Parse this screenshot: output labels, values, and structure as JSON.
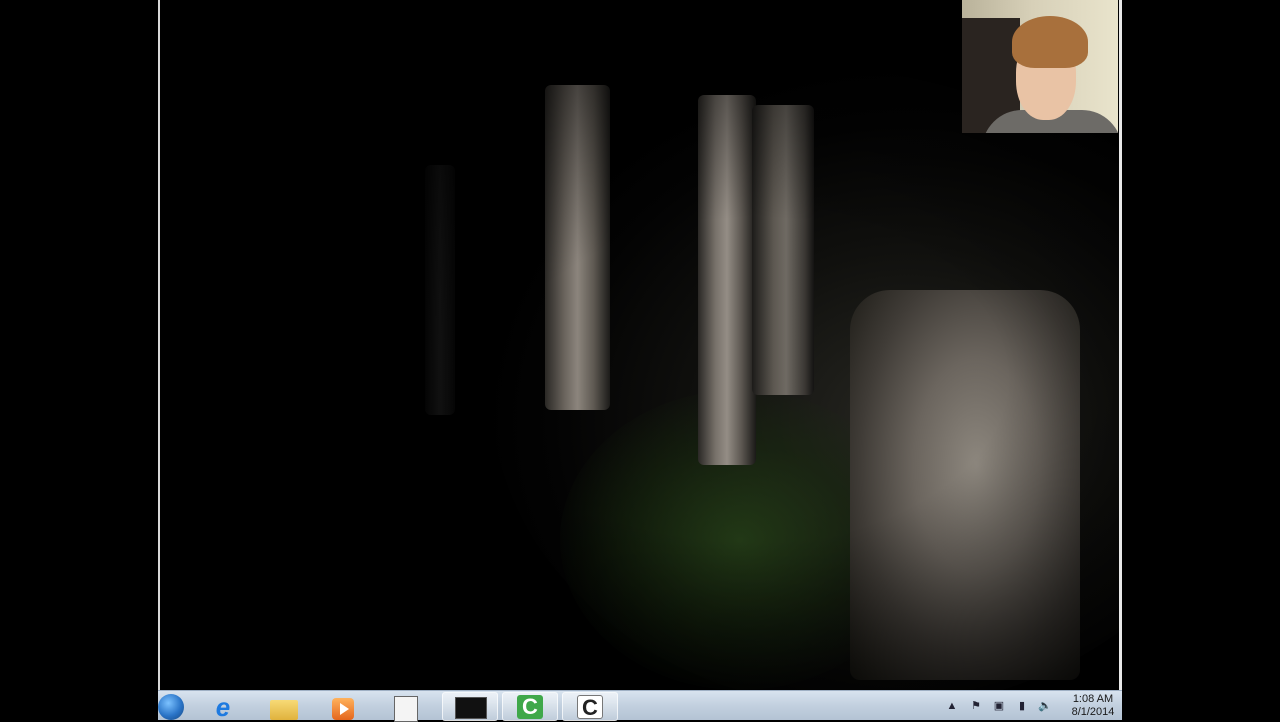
{
  "taskbar": {
    "pinned": [
      {
        "name": "start-orb"
      },
      {
        "name": "internet-explorer",
        "glyph": "e"
      },
      {
        "name": "file-explorer"
      },
      {
        "name": "media-player"
      },
      {
        "name": "app"
      }
    ],
    "running": [
      {
        "name": "game-window"
      },
      {
        "name": "camtasia-recorder",
        "glyph": "C"
      },
      {
        "name": "camtasia-studio",
        "glyph": "C"
      }
    ],
    "tray": {
      "chevron": "▲",
      "flag": "⚑",
      "usb": "▣",
      "signal": "▮",
      "volume": "🔈"
    },
    "clock": {
      "time": "1:08 AM",
      "date": "8/1/2014"
    }
  },
  "colors": {
    "taskbar_top": "#d8e3ef",
    "taskbar_bottom": "#b4c3d4",
    "flashlight": "#8d877e",
    "grass": "#28461a"
  }
}
